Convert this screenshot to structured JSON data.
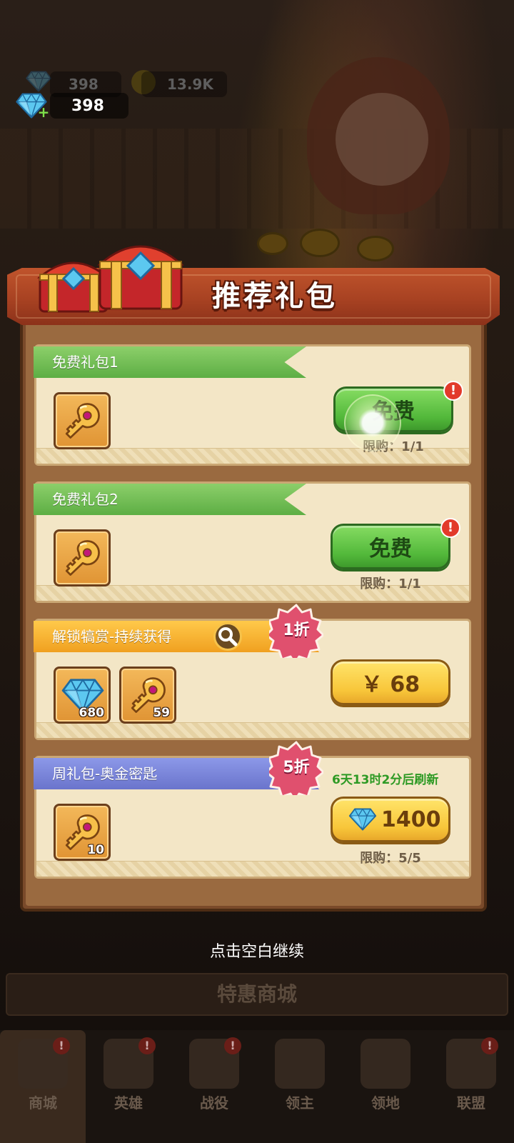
{
  "currency": {
    "gems_bg": "398",
    "coins_bg": "13.9K",
    "gems": "398"
  },
  "popup": {
    "title": "推荐礼包",
    "tap_to_continue": "点击空白继续",
    "packs": [
      {
        "name": "免费礼包1",
        "items": [
          {
            "icon": "golden-key-icon",
            "qty": ""
          }
        ],
        "button": "免费",
        "limit": "限购：1/1",
        "ribbon_color": "#6cbf50"
      },
      {
        "name": "免费礼包2",
        "items": [
          {
            "icon": "golden-key-icon",
            "qty": ""
          }
        ],
        "button": "免费",
        "limit": "限购：1/1",
        "ribbon_color": "#6cbf50"
      },
      {
        "name": "解锁犒赏-持续获得",
        "discount": "1折",
        "items": [
          {
            "icon": "diamond-icon",
            "qty": "680"
          },
          {
            "icon": "golden-key-icon",
            "qty": "59"
          }
        ],
        "button": "￥ 68",
        "ribbon_color": "#f6b632"
      },
      {
        "name": "周礼包-奥金密匙",
        "discount": "5折",
        "refresh": "6天13时2分后刷新",
        "items": [
          {
            "icon": "golden-key-icon",
            "qty": "10"
          }
        ],
        "button": "1400",
        "limit": "限购：5/5",
        "ribbon_color": "#7c86da"
      }
    ]
  },
  "shop_banner": "特惠商城",
  "nav": [
    {
      "label": "商城",
      "active": true
    },
    {
      "label": "英雄",
      "active": false
    },
    {
      "label": "战役",
      "active": false
    },
    {
      "label": "领主",
      "active": false
    },
    {
      "label": "领地",
      "active": false
    },
    {
      "label": "联盟",
      "active": false
    }
  ],
  "colors": {
    "banner": "#b04a26",
    "card": "#f3e6c6",
    "green_button": "#5ab840",
    "yellow_button": "#f8c63a",
    "discount_badge": "#e0506e",
    "refresh_text": "#2e9a24"
  }
}
